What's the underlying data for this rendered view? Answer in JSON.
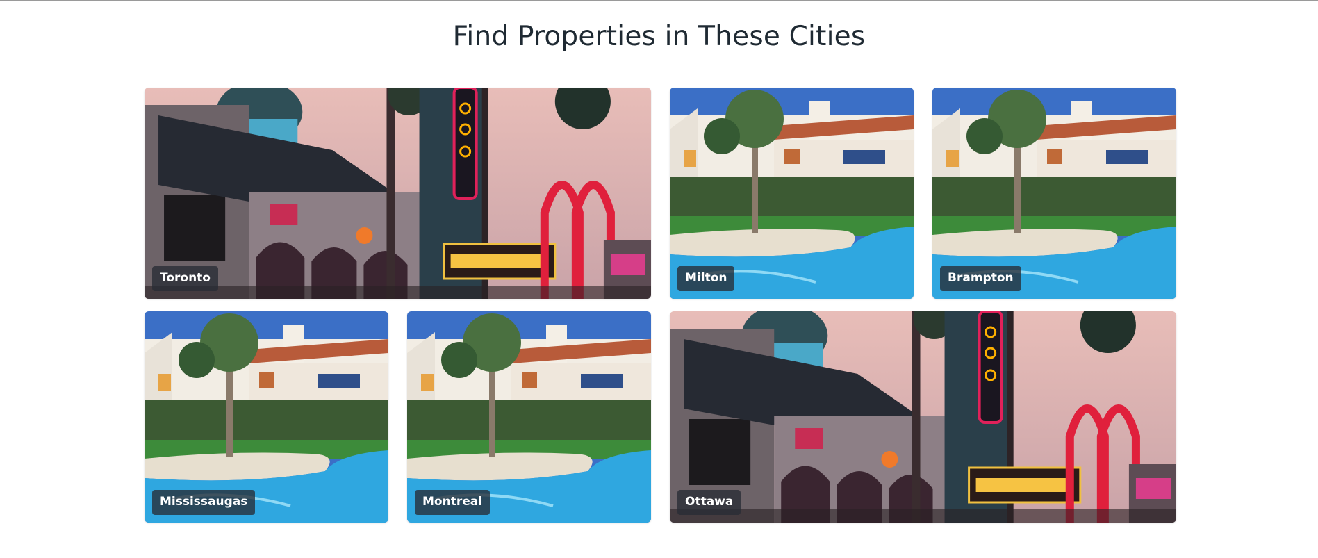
{
  "section": {
    "title": "Find Properties in These Cities"
  },
  "cities": [
    {
      "name": "Toronto",
      "image": "neon-hollywood-street"
    },
    {
      "name": "Milton",
      "image": "pool-palm-villa"
    },
    {
      "name": "Brampton",
      "image": "pool-palm-villa"
    },
    {
      "name": "Mississaugas",
      "image": "pool-palm-villa"
    },
    {
      "name": "Montreal",
      "image": "pool-palm-villa"
    },
    {
      "name": "Ottawa",
      "image": "neon-hollywood-street"
    }
  ],
  "colors": {
    "title_text": "#1f2a33",
    "label_background": "#282c34",
    "label_text": "#ffffff"
  }
}
